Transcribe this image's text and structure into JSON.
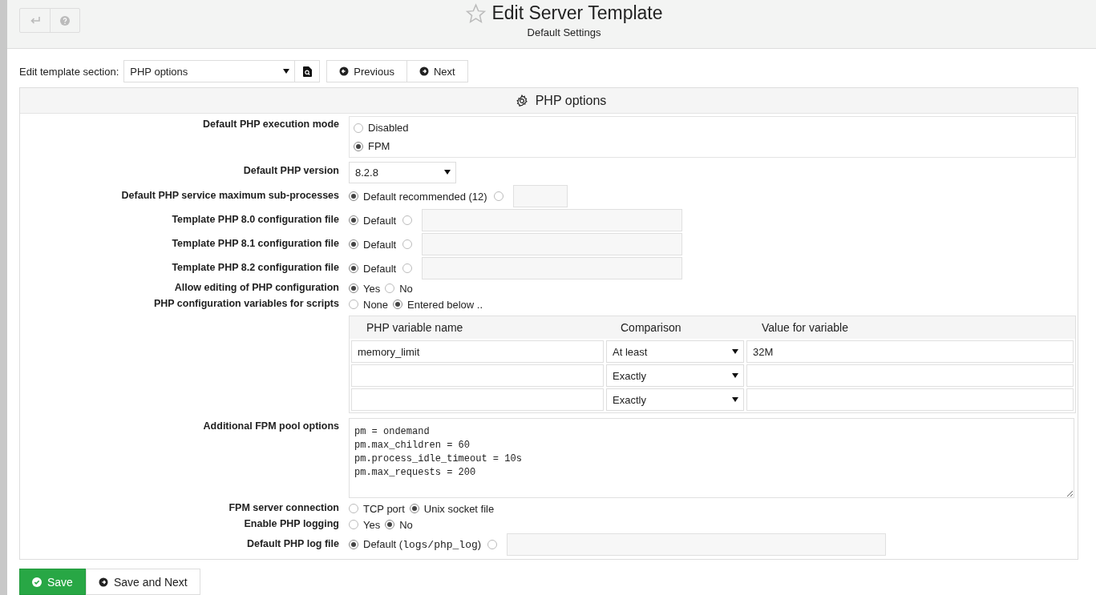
{
  "header": {
    "title": "Edit Server Template",
    "subtitle": "Default Settings"
  },
  "section_bar": {
    "label": "Edit template section:",
    "select": "PHP options",
    "buttons": [
      {
        "label": "Previous",
        "kind": "prev"
      },
      {
        "label": "Next",
        "kind": "next"
      }
    ]
  },
  "panel": {
    "title": "PHP options",
    "rows": [
      {
        "label": "Default PHP execution mode",
        "kind": "radio-stack",
        "options": [
          {
            "label": "Disabled",
            "selected": false
          },
          {
            "label": "FPM",
            "selected": true
          }
        ]
      },
      {
        "label": "Default PHP version",
        "kind": "select",
        "value": "8.2.8"
      },
      {
        "label": "Default PHP service maximum sub-processes",
        "kind": "radios-short-field",
        "options": [
          {
            "label": "Default recommended (12)",
            "selected": true
          },
          {
            "selected": false
          }
        ]
      },
      {
        "label": "Template PHP 8.0 configuration file",
        "kind": "radios-field",
        "options": [
          {
            "label": "Default",
            "selected": true
          },
          {
            "selected": false
          }
        ]
      },
      {
        "label": "Template PHP 8.1 configuration file",
        "kind": "radios-field",
        "options": [
          {
            "label": "Default",
            "selected": true
          },
          {
            "selected": false
          }
        ]
      },
      {
        "label": "Template PHP 8.2 configuration file",
        "kind": "radios-field",
        "options": [
          {
            "label": "Default",
            "selected": true
          },
          {
            "selected": false
          }
        ]
      },
      {
        "label": "Allow editing of PHP configuration",
        "kind": "radios",
        "options": [
          {
            "label": "Yes",
            "selected": true
          },
          {
            "label": "No",
            "selected": false
          }
        ]
      },
      {
        "label": "PHP configuration variables for scripts",
        "kind": "radios",
        "options": [
          {
            "label": "None",
            "selected": false
          },
          {
            "label": "Entered below ..",
            "selected": true
          }
        ]
      },
      {
        "kind": "table",
        "columns": [
          "PHP variable name",
          "Comparison",
          "Value for variable"
        ],
        "rows": [
          {
            "name": "memory_limit",
            "comparison": "At least",
            "value": "32M"
          },
          {
            "comparison": "Exactly"
          },
          {
            "comparison": "Exactly"
          }
        ]
      },
      {
        "label": "Additional FPM pool options",
        "kind": "textarea",
        "value": "pm = ondemand\npm.max_children = 60\npm.process_idle_timeout = 10s\npm.max_requests = 200"
      },
      {
        "label": "FPM server connection",
        "kind": "radios",
        "options": [
          {
            "label": "TCP port",
            "selected": false
          },
          {
            "label": "Unix socket file",
            "selected": true
          }
        ]
      },
      {
        "label": "Enable PHP logging",
        "kind": "radios",
        "options": [
          {
            "label": "Yes",
            "selected": false
          },
          {
            "label": "No",
            "selected": true
          }
        ]
      },
      {
        "label": "Default PHP log file",
        "kind": "radios-long-field",
        "options": [
          {
            "label": "Default (",
            "code": "logs/php_log",
            "after": ")",
            "selected": true
          },
          {
            "selected": false
          }
        ]
      }
    ]
  },
  "footer_buttons": [
    {
      "label": "Save",
      "kind": "primary"
    },
    {
      "label": "Save and Next",
      "kind": "secondary"
    }
  ]
}
